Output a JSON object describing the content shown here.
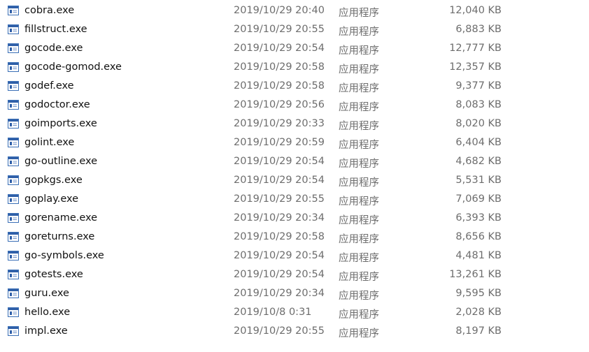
{
  "colors": {
    "icon_frame": "#3b6fb6",
    "icon_title": "#2f5fa8",
    "secondary_text": "#6d6d6d"
  },
  "files": [
    {
      "name": "cobra.exe",
      "modified": "2019/10/29 20:40",
      "type": "应用程序",
      "size": "12,040 KB",
      "icon": "application-icon"
    },
    {
      "name": "fillstruct.exe",
      "modified": "2019/10/29 20:55",
      "type": "应用程序",
      "size": "6,883 KB",
      "icon": "application-icon"
    },
    {
      "name": "gocode.exe",
      "modified": "2019/10/29 20:54",
      "type": "应用程序",
      "size": "12,777 KB",
      "icon": "application-icon"
    },
    {
      "name": "gocode-gomod.exe",
      "modified": "2019/10/29 20:58",
      "type": "应用程序",
      "size": "12,357 KB",
      "icon": "application-icon"
    },
    {
      "name": "godef.exe",
      "modified": "2019/10/29 20:58",
      "type": "应用程序",
      "size": "9,377 KB",
      "icon": "application-icon"
    },
    {
      "name": "godoctor.exe",
      "modified": "2019/10/29 20:56",
      "type": "应用程序",
      "size": "8,083 KB",
      "icon": "application-icon"
    },
    {
      "name": "goimports.exe",
      "modified": "2019/10/29 20:33",
      "type": "应用程序",
      "size": "8,020 KB",
      "icon": "application-icon"
    },
    {
      "name": "golint.exe",
      "modified": "2019/10/29 20:59",
      "type": "应用程序",
      "size": "6,404 KB",
      "icon": "application-icon"
    },
    {
      "name": "go-outline.exe",
      "modified": "2019/10/29 20:54",
      "type": "应用程序",
      "size": "4,682 KB",
      "icon": "application-icon"
    },
    {
      "name": "gopkgs.exe",
      "modified": "2019/10/29 20:54",
      "type": "应用程序",
      "size": "5,531 KB",
      "icon": "application-icon"
    },
    {
      "name": "goplay.exe",
      "modified": "2019/10/29 20:55",
      "type": "应用程序",
      "size": "7,069 KB",
      "icon": "application-icon"
    },
    {
      "name": "gorename.exe",
      "modified": "2019/10/29 20:34",
      "type": "应用程序",
      "size": "6,393 KB",
      "icon": "application-icon"
    },
    {
      "name": "goreturns.exe",
      "modified": "2019/10/29 20:58",
      "type": "应用程序",
      "size": "8,656 KB",
      "icon": "application-icon"
    },
    {
      "name": "go-symbols.exe",
      "modified": "2019/10/29 20:54",
      "type": "应用程序",
      "size": "4,481 KB",
      "icon": "application-icon"
    },
    {
      "name": "gotests.exe",
      "modified": "2019/10/29 20:54",
      "type": "应用程序",
      "size": "13,261 KB",
      "icon": "application-icon"
    },
    {
      "name": "guru.exe",
      "modified": "2019/10/29 20:34",
      "type": "应用程序",
      "size": "9,595 KB",
      "icon": "application-icon"
    },
    {
      "name": "hello.exe",
      "modified": "2019/10/8 0:31",
      "type": "应用程序",
      "size": "2,028 KB",
      "icon": "application-icon"
    },
    {
      "name": "impl.exe",
      "modified": "2019/10/29 20:55",
      "type": "应用程序",
      "size": "8,197 KB",
      "icon": "application-icon"
    }
  ]
}
